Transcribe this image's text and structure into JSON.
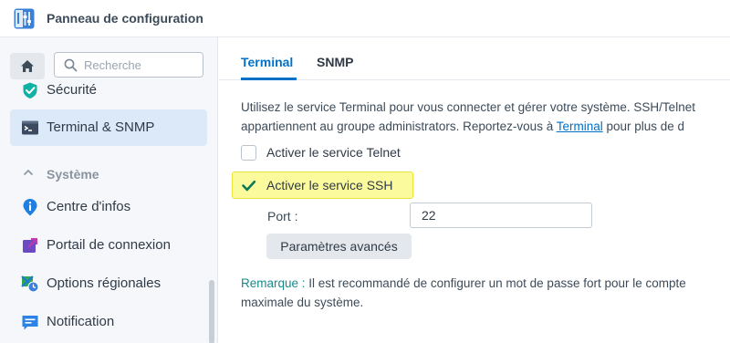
{
  "window": {
    "title": "Panneau de configuration"
  },
  "sidebar": {
    "search_placeholder": "Recherche",
    "items": {
      "securite": "Sécurité",
      "terminal": "Terminal & SNMP",
      "centre_infos": "Centre d'infos",
      "portail": "Portail de connexion",
      "options_regionales": "Options régionales",
      "notification": "Notification"
    },
    "section_systeme": "Système"
  },
  "tabs": [
    "Terminal",
    "SNMP"
  ],
  "main": {
    "description_line1": "Utilisez le service Terminal pour vous connecter et gérer votre système. SSH/Telnet",
    "description_line2_before": "appartiennent au groupe administrators. Reportez-vous à ",
    "description_link": "Terminal",
    "description_line2_after": " pour plus de d",
    "telnet_label": "Activer le service Telnet",
    "telnet_checked": false,
    "ssh_label": "Activer le service SSH",
    "ssh_checked": true,
    "port_label": "Port :",
    "port_value": "22",
    "advanced_button": "Paramètres avancés",
    "note_label": "Remarque :",
    "note_line1": " Il est recommandé de configurer un mot de passe fort pour le compte",
    "note_line2": "maximale du système."
  },
  "colors": {
    "accent": "#0070c9",
    "active_nav": "#dbe9f9",
    "highlight": "#fbfb9e",
    "check": "#0d7a55",
    "note": "#1a8a8a"
  },
  "icons": {
    "app": "control-panel-icon",
    "home": "home-icon",
    "search": "search-icon",
    "securite": "shield-check-icon",
    "terminal": "terminal-icon",
    "centre_infos": "info-icon",
    "portail": "portal-arrow-icon",
    "options_regionales": "globe-clock-icon",
    "notification": "chat-bubble-icon"
  }
}
